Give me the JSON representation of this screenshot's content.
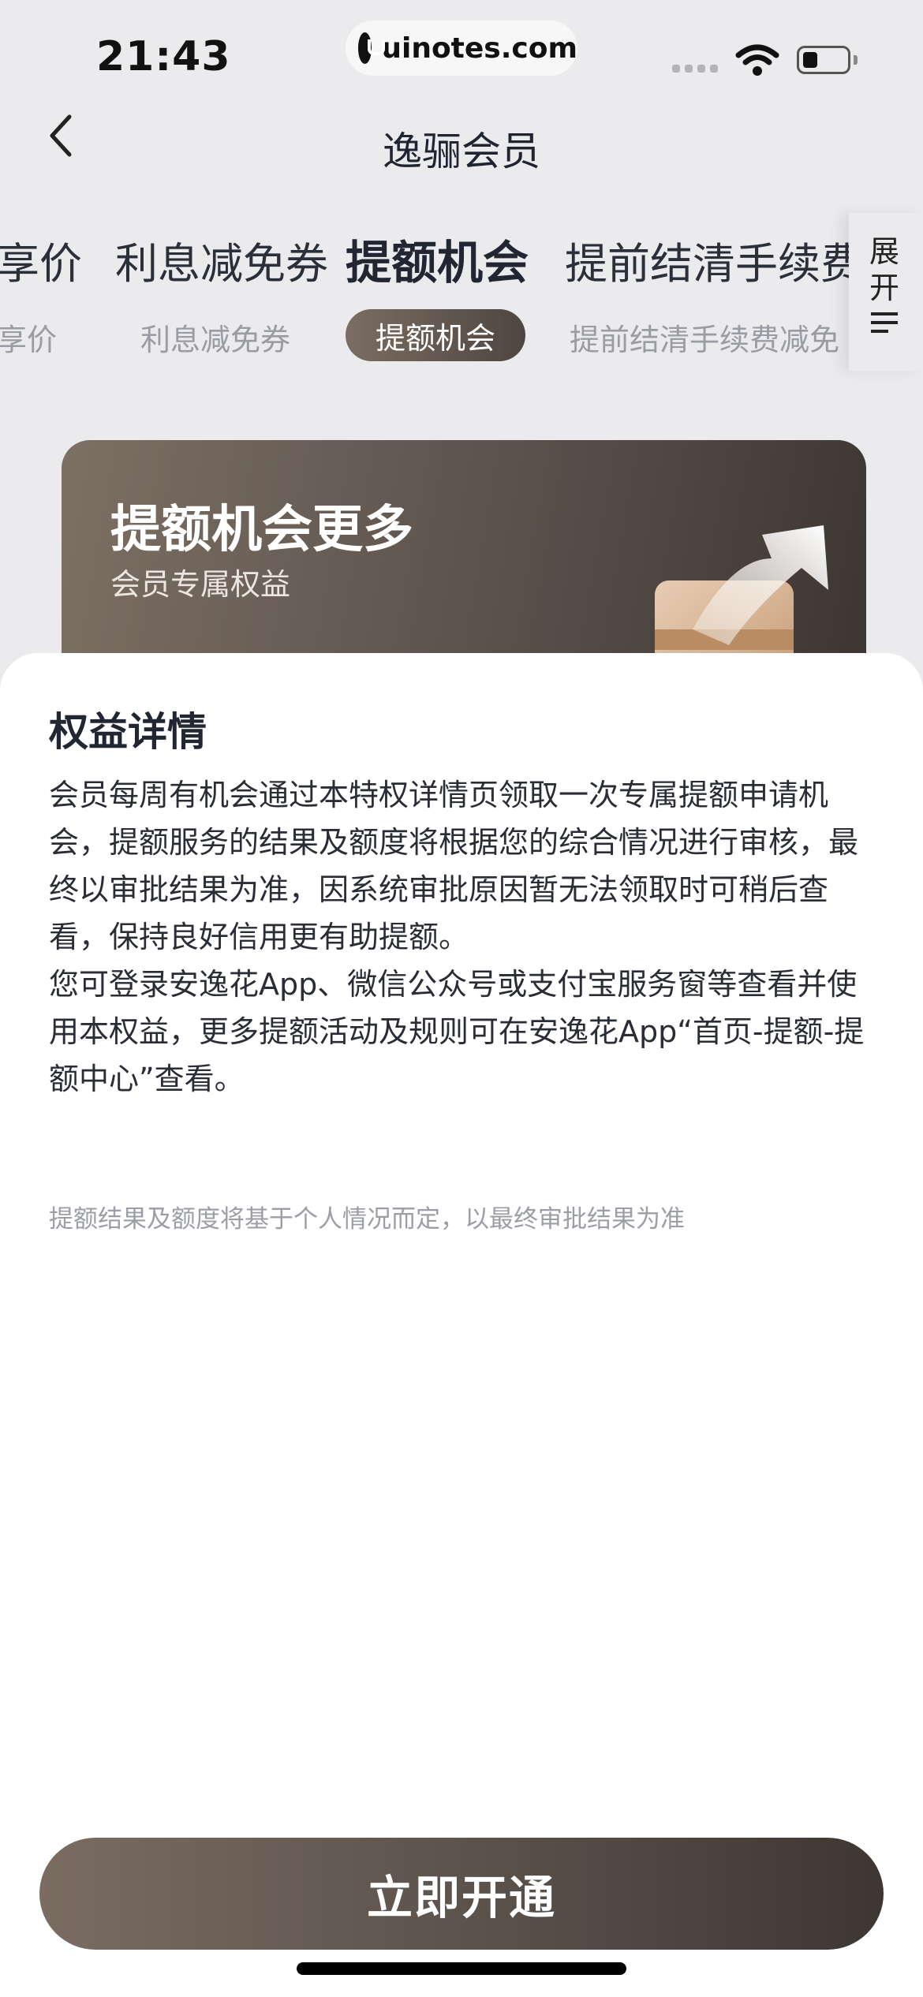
{
  "status_bar": {
    "time": "21:43",
    "url": "uinotes.com"
  },
  "nav": {
    "title": "逸骊会员",
    "back_icon": "chevron-left-icon"
  },
  "tabs": {
    "items": [
      {
        "label": "享价"
      },
      {
        "label": "利息减免券"
      },
      {
        "label": "提额机会",
        "active": true
      },
      {
        "label": "提前结清手续费"
      }
    ],
    "sub_items": [
      {
        "label": "享价"
      },
      {
        "label": "利息减免券"
      },
      {
        "label": "提额机会",
        "active": true
      },
      {
        "label": "提前结清手续费减免"
      }
    ],
    "expand_label": "展开",
    "expand_icon": "list-lines-icon"
  },
  "banner": {
    "title": "提额机会更多",
    "subtitle": "会员专属权益",
    "art_icon": "box-arrow-up-icon"
  },
  "sheet": {
    "title": "权益详情",
    "paragraph_1": "会员每周有机会通过本特权详情页领取一次专属提额申请机会，提额服务的结果及额度将根据您的综合情况进行审核，最终以审批结果为准，因系统审批原因暂无法领取时可稍后查看，保持良好信用更有助提额。",
    "paragraph_2": "您可登录安逸花App、微信公众号或支付宝服务窗等查看并使用本权益，更多提额活动及规则可在安逸花App“首页-提额-提额中心”查看。",
    "note": "提额结果及额度将基于个人情况而定，以最终审批结果为准"
  },
  "cta": {
    "label": "立即开通"
  },
  "colors": {
    "accent_dark": "#3d3733",
    "accent_light": "#7a6c61",
    "page_bg": "#ebebee"
  }
}
